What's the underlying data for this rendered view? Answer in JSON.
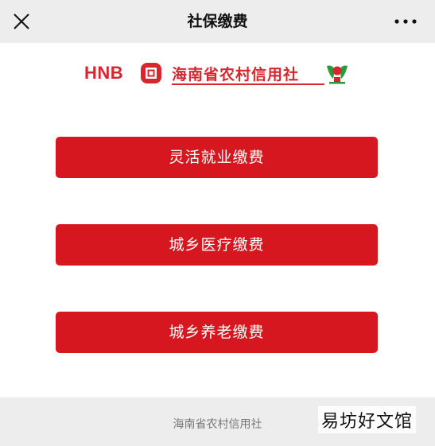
{
  "navbar": {
    "title": "社保缴费",
    "close_icon": "close-icon",
    "more_icon": "more-dots-icon"
  },
  "logo": {
    "brand": "HNB",
    "name": "海南省农村信用社",
    "brand_color": "#d7262e"
  },
  "buttons": [
    {
      "label": "灵活就业缴费"
    },
    {
      "label": "城乡医疗缴费"
    },
    {
      "label": "城乡养老缴费"
    }
  ],
  "footer": {
    "text": "海南省农村信用社"
  },
  "watermark": {
    "text": "易坊好文馆"
  },
  "colors": {
    "button_red": "#d7171f",
    "navbar_bg": "#ededed"
  }
}
